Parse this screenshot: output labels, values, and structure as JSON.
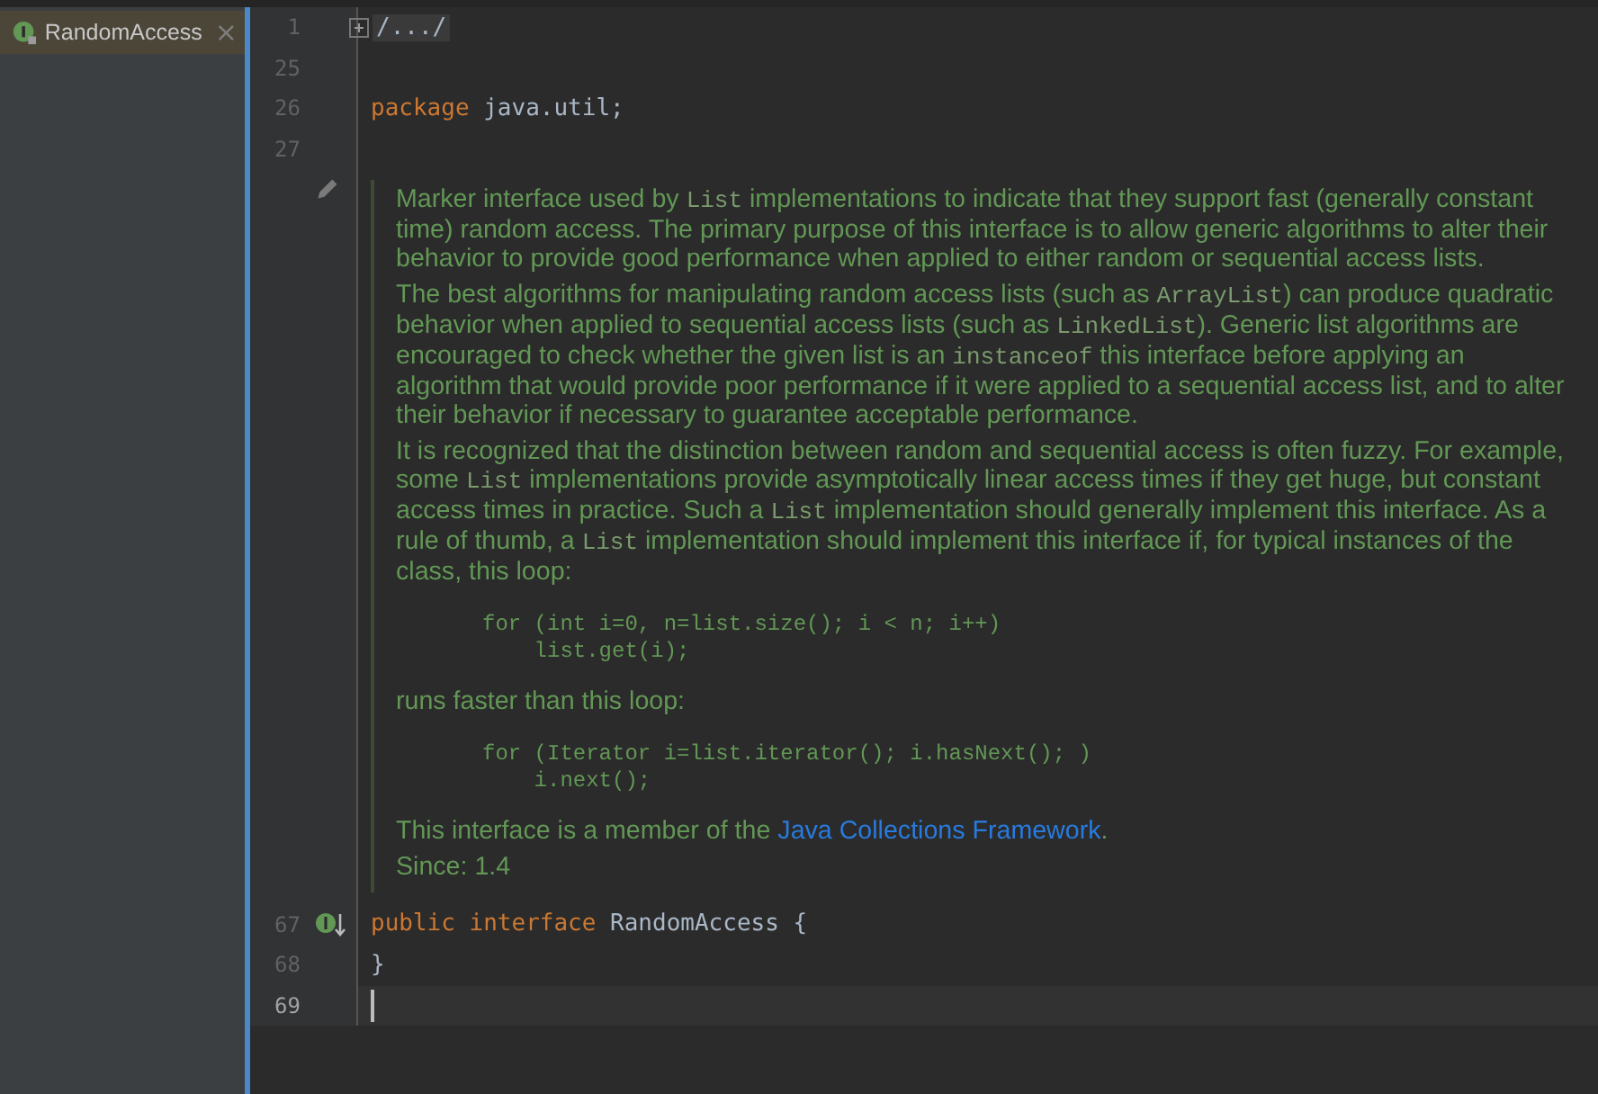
{
  "tab": {
    "label": "RandomAccess",
    "selected": true,
    "close": "×"
  },
  "lines": [
    {
      "number": "1",
      "kind": "fold",
      "text": "/.../",
      "current": false
    },
    {
      "number": "25",
      "kind": "blank",
      "current": false
    },
    {
      "number": "26",
      "kind": "code",
      "current": false,
      "tokens": [
        {
          "kind": "keyword",
          "text": "package"
        },
        {
          "kind": "plain",
          "text": "java.util;"
        }
      ]
    },
    {
      "number": "27",
      "kind": "blank",
      "current": false
    },
    {
      "kind": "doc",
      "blocks": [
        {
          "kind": "para",
          "parts": [
            {
              "kind": "text",
              "text": "Marker interface used by "
            },
            {
              "kind": "code",
              "text": "List"
            },
            {
              "kind": "text",
              "text": " implementations to indicate that they support fast (generally constant time) random access. The primary purpose of this interface is to allow generic algorithms to alter their behavior to provide good performance when applied to either random or sequential access lists."
            }
          ]
        },
        {
          "kind": "para",
          "parts": [
            {
              "kind": "text",
              "text": "The best algorithms for manipulating random access lists (such as "
            },
            {
              "kind": "code",
              "text": "ArrayList"
            },
            {
              "kind": "text",
              "text": ") can produce quadratic behavior when applied to sequential access lists (such as "
            },
            {
              "kind": "code",
              "text": "LinkedList"
            },
            {
              "kind": "text",
              "text": "). Generic list algorithms are encouraged to check whether the given list is an "
            },
            {
              "kind": "code",
              "text": "instanceof"
            },
            {
              "kind": "text",
              "text": " this interface before applying an algorithm that would provide poor performance if it were applied to a sequential access list, and to alter their behavior if necessary to guarantee acceptable performance."
            }
          ]
        },
        {
          "kind": "para",
          "parts": [
            {
              "kind": "text",
              "text": "It is recognized that the distinction between random and sequential access is often fuzzy. For example, some "
            },
            {
              "kind": "code",
              "text": "List"
            },
            {
              "kind": "text",
              "text": " implementations provide asymptotically linear access times if they get huge, but constant access times in practice. Such a "
            },
            {
              "kind": "code",
              "text": "List"
            },
            {
              "kind": "text",
              "text": " implementation should generally implement this interface. As a rule of thumb, a "
            },
            {
              "kind": "code",
              "text": "List"
            },
            {
              "kind": "text",
              "text": " implementation should implement this interface if, for typical instances of the class, this loop:"
            }
          ]
        },
        {
          "kind": "pre",
          "lines": [
            "for (int i=0, n=list.size(); i < n; i++)",
            "    list.get(i);"
          ]
        },
        {
          "kind": "para",
          "parts": [
            {
              "kind": "text",
              "text": "runs faster than this loop:"
            }
          ]
        },
        {
          "kind": "pre",
          "lines": [
            "for (Iterator i=list.iterator(); i.hasNext(); )",
            "    i.next();"
          ]
        },
        {
          "kind": "para",
          "parts": [
            {
              "kind": "text",
              "text": "This interface is a member of the "
            },
            {
              "kind": "link",
              "text": "Java Collections Framework"
            },
            {
              "kind": "text",
              "text": "."
            }
          ]
        },
        {
          "kind": "para",
          "parts": [
            {
              "kind": "text",
              "text": "Since: 1.4"
            }
          ]
        }
      ]
    },
    {
      "number": "67",
      "kind": "code",
      "current": false,
      "marker": true,
      "tokens": [
        {
          "kind": "keyword",
          "text": "public"
        },
        {
          "kind": "keyword",
          "text": "interface"
        },
        {
          "kind": "plain",
          "text": "RandomAccess {"
        }
      ]
    },
    {
      "number": "68",
      "kind": "code",
      "current": false,
      "tokens": [
        {
          "kind": "plain",
          "text": "}"
        }
      ]
    },
    {
      "number": "69",
      "kind": "caret",
      "current": true
    }
  ]
}
